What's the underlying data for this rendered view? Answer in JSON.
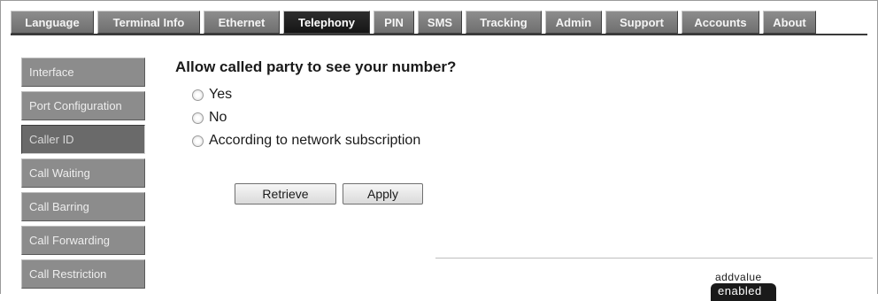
{
  "topnav": {
    "tabs": [
      {
        "label": "Language"
      },
      {
        "label": "Terminal Info"
      },
      {
        "label": "Ethernet"
      },
      {
        "label": "Telephony"
      },
      {
        "label": "PIN"
      },
      {
        "label": "SMS"
      },
      {
        "label": "Tracking"
      },
      {
        "label": "Admin"
      },
      {
        "label": "Support"
      },
      {
        "label": "Accounts"
      },
      {
        "label": "About"
      }
    ],
    "active": "Telephony"
  },
  "sidebar": {
    "items": [
      {
        "label": "Interface"
      },
      {
        "label": "Port Configuration"
      },
      {
        "label": "Caller ID"
      },
      {
        "label": "Call Waiting"
      },
      {
        "label": "Call Barring"
      },
      {
        "label": "Call Forwarding"
      },
      {
        "label": "Call Restriction"
      }
    ],
    "active": "Caller ID"
  },
  "main": {
    "question": "Allow called party to see your number?",
    "options": [
      {
        "label": "Yes",
        "selected": false
      },
      {
        "label": "No",
        "selected": false
      },
      {
        "label": "According to network subscription",
        "selected": false
      }
    ],
    "retrieve_label": "Retrieve",
    "apply_label": "Apply"
  },
  "logo": {
    "line1": "addvalue",
    "line2": "enabled"
  }
}
